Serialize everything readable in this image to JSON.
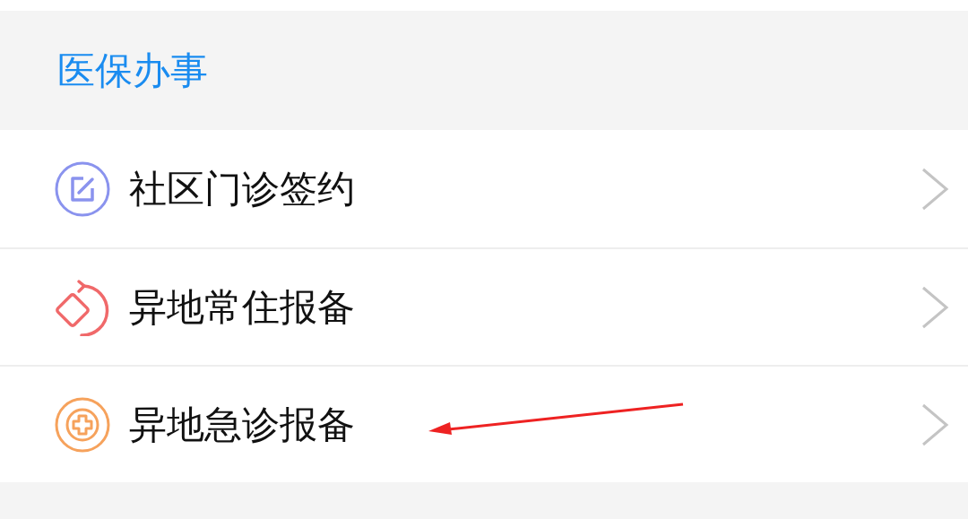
{
  "section": {
    "title": "医保办事"
  },
  "items": [
    {
      "label": "社区门诊签约",
      "kind": "edit",
      "color": "#8a93ee"
    },
    {
      "label": "异地常住报备",
      "kind": "rotate",
      "color": "#f0696a"
    },
    {
      "label": "异地急诊报备",
      "kind": "medical",
      "color": "#f6a25c"
    }
  ]
}
